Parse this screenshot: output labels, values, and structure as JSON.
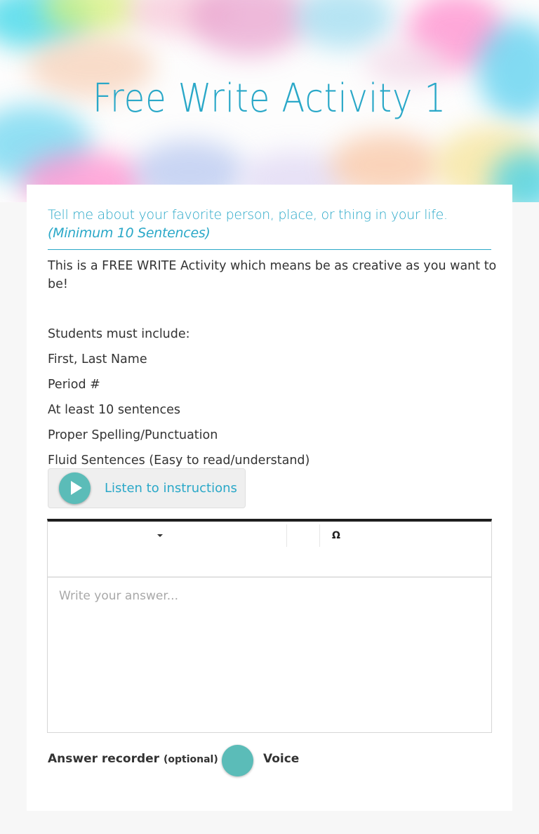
{
  "header": {
    "title": "Free Write Activity 1"
  },
  "prompt": {
    "question": "Tell me about your favorite person, place, or thing in your life.",
    "note": "(Minimum 10 Sentences)"
  },
  "instructions": {
    "intro": "This is a FREE WRITE Activity which means be as creative as you want to be!",
    "requirements_heading": "Students must include:",
    "requirements": [
      "First, Last Name",
      "Period #",
      "At least 10 sentences",
      "Proper Spelling/Punctuation",
      "Fluid Sentences (Easy to read/understand)"
    ]
  },
  "listen_button": {
    "label": "Listen to instructions",
    "icon": "play-icon"
  },
  "editor": {
    "special_char_label": "Ω",
    "answer_placeholder": "Write your answer..."
  },
  "recorder": {
    "label": "Answer recorder",
    "optional": "(optional)",
    "dash": "-",
    "voice_label": "Voice",
    "icon": "microphone-button"
  },
  "colors": {
    "accent": "#2aa8c8",
    "button_teal": "#5bbcb8",
    "page_bg": "#f7f7f7",
    "toolbar_border": "#1f1f1f"
  }
}
